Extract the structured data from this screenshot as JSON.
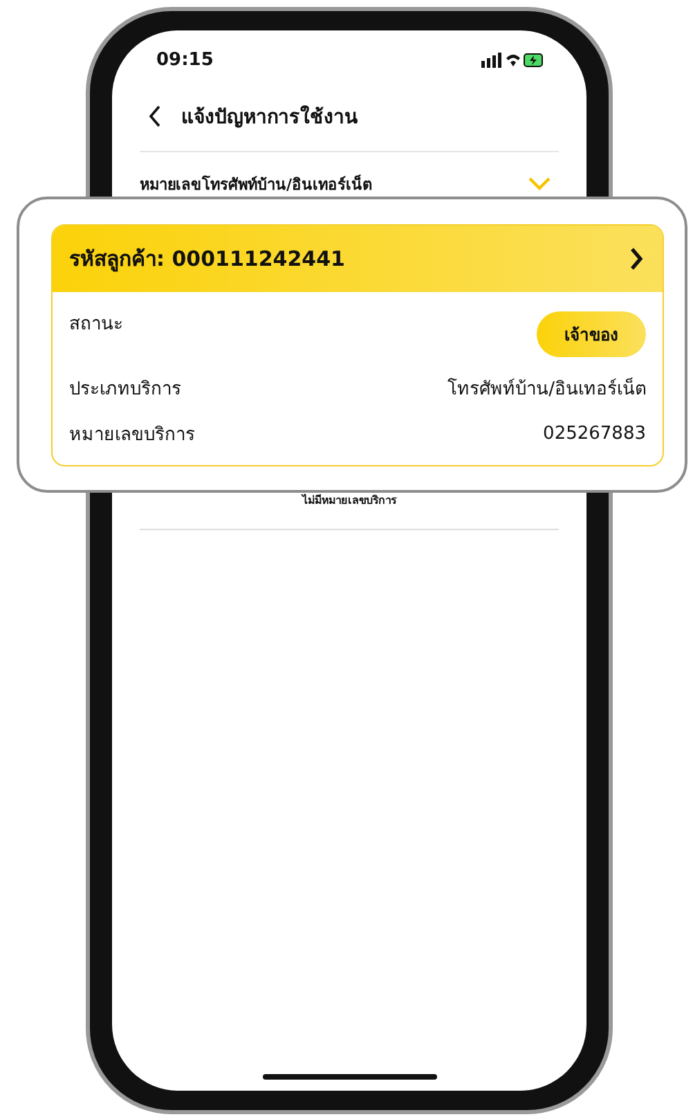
{
  "status_bar": {
    "time": "09:15"
  },
  "header": {
    "title": "แจ้งปัญหาการใช้งาน"
  },
  "dropdown": {
    "label": "หมายเลขโทรศัพท์บ้าน/อินเทอร์เน็ต",
    "expanded": true
  },
  "empty_message": "ไม่มีหมายเลขบริการ",
  "card": {
    "title": "รหัสลูกค้า: 000111242441",
    "rows": [
      {
        "kind": "badge",
        "label": "สถานะ",
        "value": "เจ้าของ"
      },
      {
        "kind": "text",
        "label": "ประเภทบริการ",
        "value": "โทรศัพท์บ้าน/อินเทอร์เน็ต"
      },
      {
        "kind": "text",
        "label": "หมายเลขบริการ",
        "value": "025267883"
      }
    ]
  }
}
